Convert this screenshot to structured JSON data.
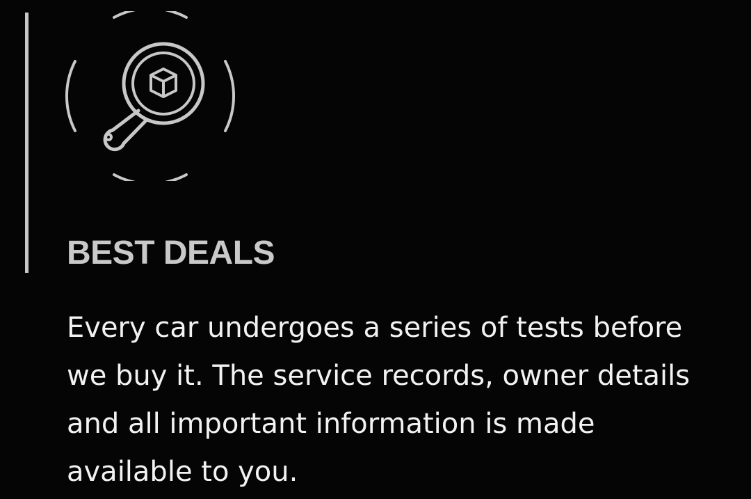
{
  "feature": {
    "icon": "magnifier-box-icon",
    "title": "BEST DEALS",
    "description": "Every car undergoes a series of tests before we buy it. The service records, owner details and all important information is made available to you."
  },
  "colors": {
    "background": "#050505",
    "accent": "#c8c8c8",
    "title": "#c9c9c9",
    "text": "#f2f2f2"
  }
}
